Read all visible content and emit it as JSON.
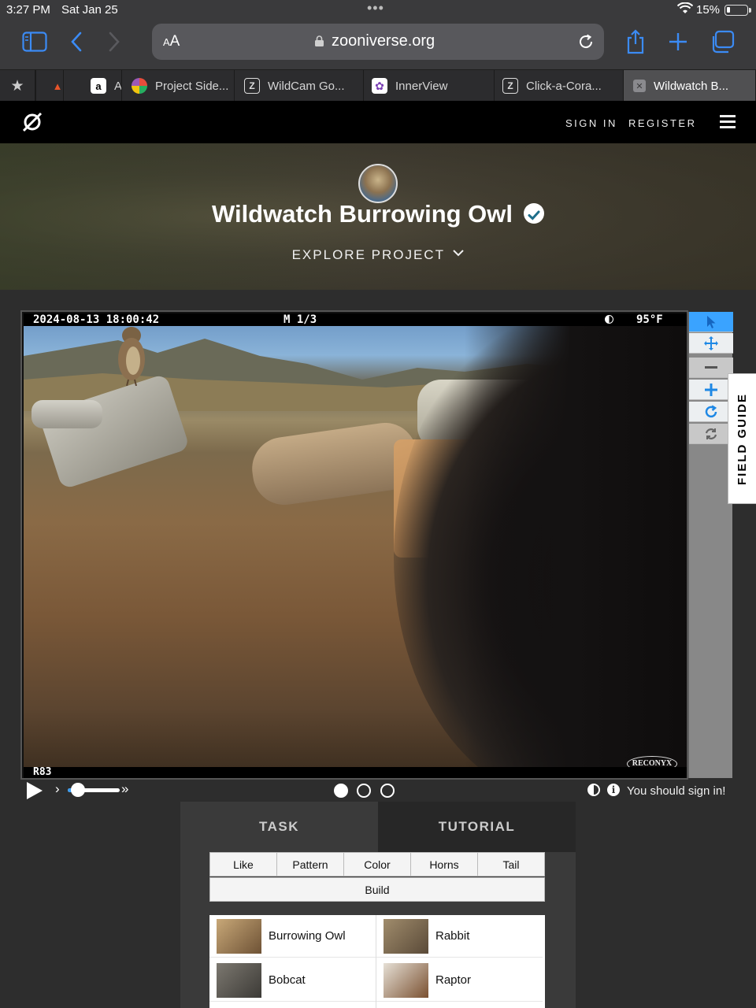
{
  "status_bar": {
    "time": "3:27 PM",
    "date": "Sat Jan 25",
    "battery": "15%"
  },
  "browser": {
    "text_size_label": "AA",
    "url": "zooniverse.org",
    "tabs": [
      {
        "label": "",
        "favicon": "bookmarks-star-icon"
      },
      {
        "label": "",
        "favicon": "fire-icon"
      },
      {
        "label": "A",
        "favicon": "amazon-icon"
      },
      {
        "label": "Project Side...",
        "favicon": "colorful-logo-icon"
      },
      {
        "label": "WildCam Go...",
        "favicon": "zooniverse-z-icon"
      },
      {
        "label": "InnerView",
        "favicon": "innerview-icon"
      },
      {
        "label": "Click-a-Cora...",
        "favicon": "zooniverse-z-icon"
      },
      {
        "label": "Wildwatch B...",
        "favicon": "close-tab-icon"
      }
    ]
  },
  "site_nav": {
    "sign_in": "SIGN IN",
    "register": "REGISTER"
  },
  "project": {
    "title": "Wildwatch Burrowing Owl",
    "explore": "EXPLORE PROJECT"
  },
  "subject": {
    "stamp_datetime": "2024-08-13 18:00:42",
    "stamp_mode": "M 1/3",
    "stamp_temp": "95°F",
    "stamp_code": "R83",
    "camera_brand": "RECONYX",
    "frames": 3,
    "current_frame": 1,
    "playback_speed": 0.2
  },
  "field_guide": "FIELD GUIDE",
  "controls": {
    "sign_in_message": "You should sign in!"
  },
  "task_tabs": {
    "task": "TASK",
    "tutorial": "TUTORIAL"
  },
  "filters": [
    "Like",
    "Pattern",
    "Color",
    "Horns",
    "Tail",
    "Build"
  ],
  "species": [
    "Burrowing Owl",
    "Rabbit",
    "Bobcat",
    "Raptor"
  ],
  "colors": {
    "accent": "#3aa3ff",
    "nav_bg": "#000000",
    "page_bg": "#2d2d2d",
    "safari_blue": "#3b8bf5"
  }
}
